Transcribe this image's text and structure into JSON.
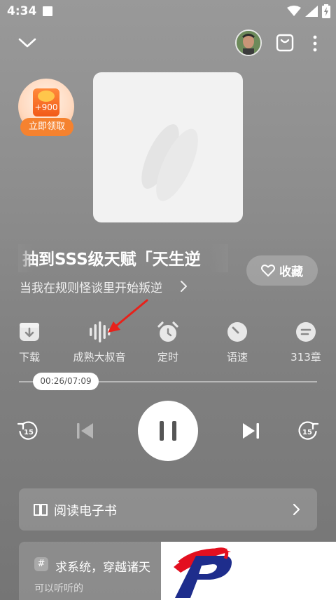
{
  "status_bar": {
    "time": "4:34"
  },
  "reward": {
    "amount": "+900",
    "label": "立即领取"
  },
  "book": {
    "title": "抽到SSS级天赋「天生逆",
    "subtitle": "当我在规则怪谈里开始叛逆",
    "favorite_label": "收藏"
  },
  "functions": [
    {
      "label": "下载",
      "icon": "download-icon"
    },
    {
      "label": "成熟大叔音",
      "icon": "voice-waveform-icon"
    },
    {
      "label": "定时",
      "icon": "alarm-clock-icon"
    },
    {
      "label": "语速",
      "icon": "speed-gauge-icon"
    },
    {
      "label": "313章",
      "icon": "chapter-list-icon"
    }
  ],
  "progress": {
    "time_label": "00:26/07:09",
    "elapsed_fraction": 0.06
  },
  "controls": {
    "rewind_seconds": "15",
    "forward_seconds": "15"
  },
  "read_ebook": {
    "label": "阅读电子书"
  },
  "recommendation": {
    "title": "求系统，穿越诸天",
    "subtitle": "可以听听的"
  },
  "colors": {
    "accent_orange": "#f5822f",
    "annotation_red": "#e8211a",
    "logo_red": "#e30f1f",
    "logo_blue": "#1e2d8c"
  }
}
